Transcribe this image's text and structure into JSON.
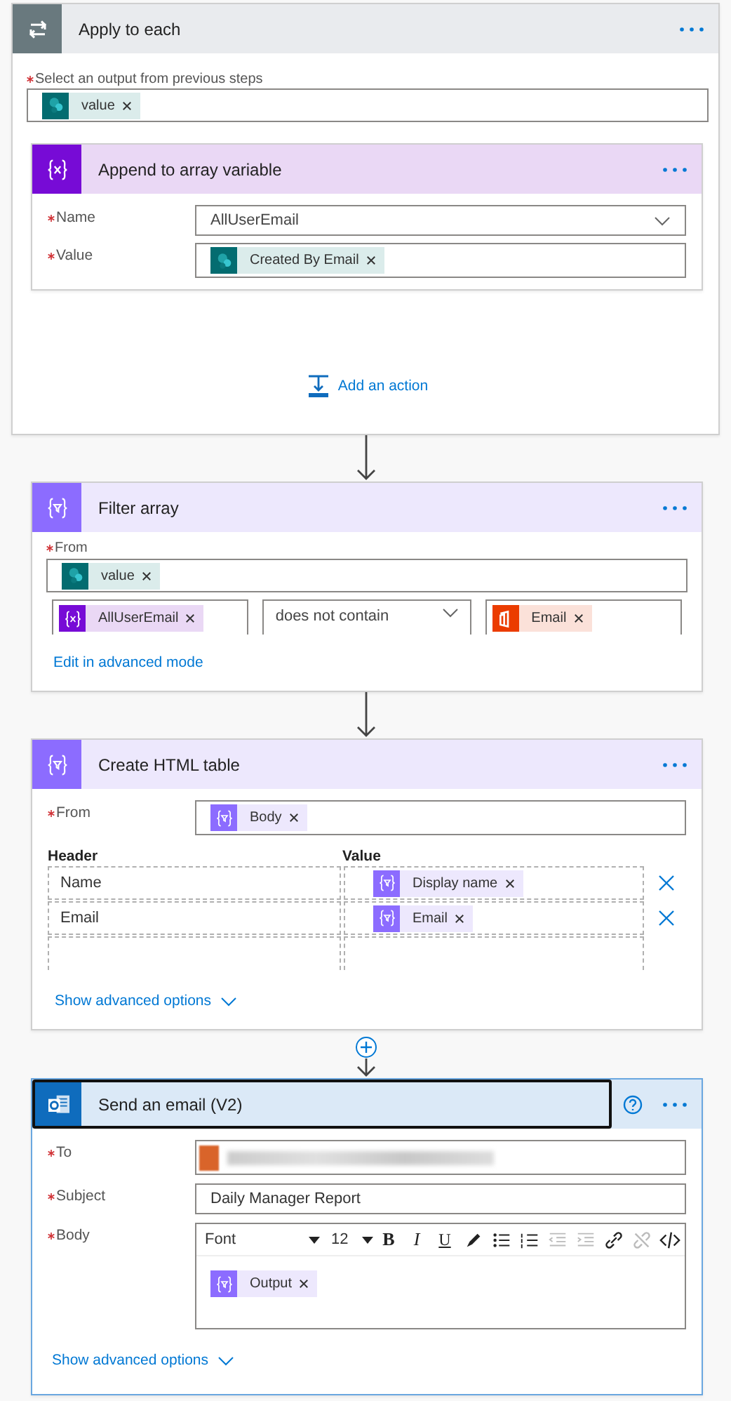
{
  "apply_each": {
    "kind": "control",
    "title": "Apply to each",
    "select": {
      "label": "Select an output from previous steps",
      "required": true,
      "tokens": [
        {
          "kind": "sharepoint",
          "label": "value"
        }
      ]
    },
    "inner": {
      "kind": "variable",
      "title": "Append to array variable",
      "fields": [
        {
          "kind": "dropdown",
          "label": "Name",
          "required": true,
          "value": "AllUserEmail"
        },
        {
          "kind": "tokens",
          "label": "Value",
          "required": true,
          "tokens": [
            {
              "kind": "sharepoint",
              "label": "Created By Email"
            }
          ]
        }
      ]
    },
    "add_action": "Add an action"
  },
  "filter": {
    "kind": "data",
    "title": "Filter array",
    "from": {
      "label": "From",
      "required": true,
      "tokens": [
        {
          "kind": "sharepoint",
          "label": "value"
        }
      ]
    },
    "condition": {
      "left": [
        {
          "kind": "variable",
          "label": "AllUserEmail"
        }
      ],
      "operator": "does not contain",
      "right": [
        {
          "kind": "office",
          "label": "Email"
        }
      ]
    },
    "advanced_link": "Edit in advanced mode"
  },
  "table": {
    "kind": "data",
    "title": "Create HTML table",
    "from": {
      "label": "From",
      "required": true,
      "tokens": [
        {
          "kind": "data",
          "label": "Body"
        }
      ]
    },
    "header_col": "Header",
    "value_col": "Value",
    "rows": [
      {
        "header": "Name",
        "tokens": [
          {
            "kind": "data",
            "label": "Display name"
          }
        ]
      },
      {
        "header": "Email",
        "tokens": [
          {
            "kind": "data",
            "label": "Email"
          }
        ]
      }
    ],
    "advanced_link": "Show advanced options"
  },
  "email": {
    "kind": "outlook",
    "title": "Send an email (V2)",
    "selected": true,
    "fields": [
      {
        "kind": "redacted",
        "label": "To",
        "required": true
      },
      {
        "kind": "text",
        "label": "Subject",
        "required": true,
        "value": "Daily Manager Report"
      },
      {
        "kind": "editor",
        "label": "Body",
        "required": true,
        "font": "Font",
        "size": "12",
        "toolbar": [
          {
            "kind": "bold",
            "label": "B",
            "disabled": false
          },
          {
            "kind": "italic",
            "label": "I",
            "disabled": false
          },
          {
            "kind": "underline",
            "label": "U",
            "disabled": false
          },
          {
            "kind": "pen",
            "disabled": false
          },
          {
            "kind": "bullets",
            "disabled": false
          },
          {
            "kind": "numbers",
            "disabled": false
          },
          {
            "kind": "outdent",
            "disabled": true
          },
          {
            "kind": "indent",
            "disabled": true
          },
          {
            "kind": "link",
            "disabled": false
          },
          {
            "kind": "unlink",
            "disabled": true
          },
          {
            "kind": "code",
            "disabled": false
          }
        ],
        "tokens": [
          {
            "kind": "data",
            "label": "Output"
          }
        ]
      }
    ],
    "advanced_link": "Show advanced options"
  }
}
